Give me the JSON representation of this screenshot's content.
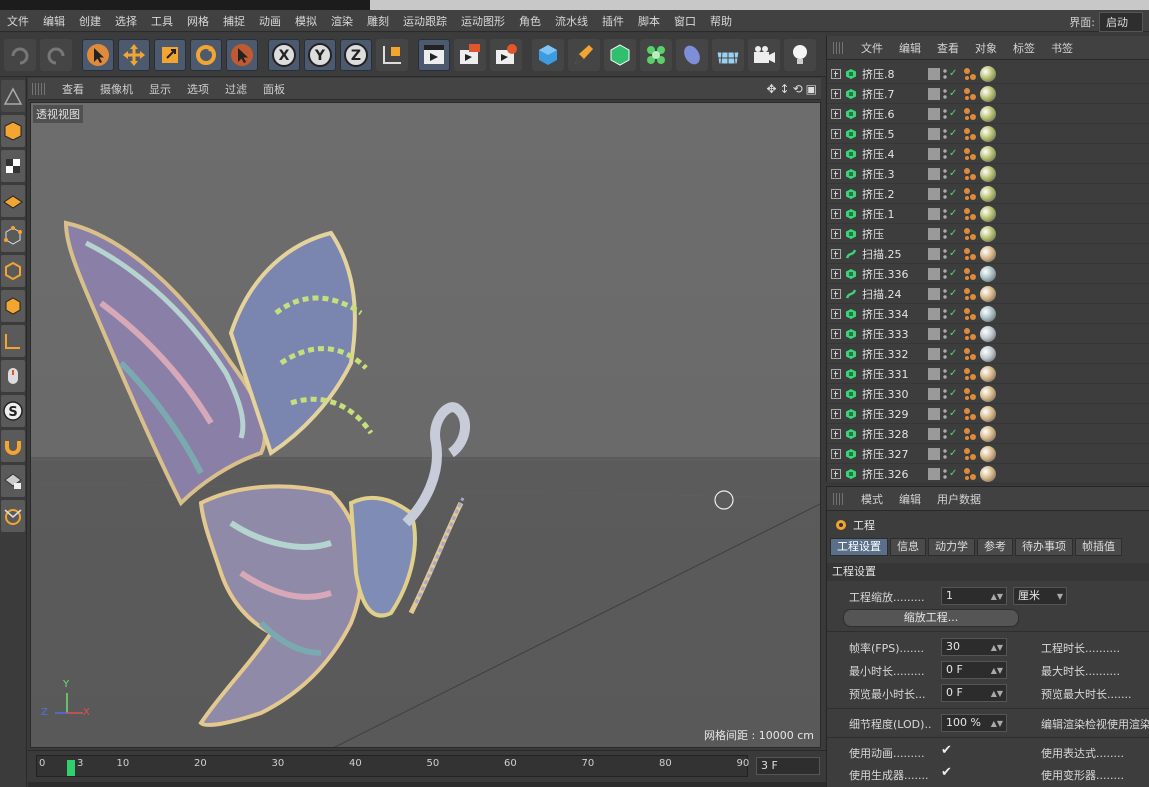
{
  "menus": [
    "文件",
    "编辑",
    "创建",
    "选择",
    "工具",
    "网格",
    "捕捉",
    "动画",
    "模拟",
    "渲染",
    "雕刻",
    "运动跟踪",
    "运动图形",
    "角色",
    "流水线",
    "插件",
    "脚本",
    "窗口",
    "帮助"
  ],
  "layout": {
    "label": "界面:",
    "value": "启动"
  },
  "toolbar_icons": [
    "undo-icon",
    "redo-icon",
    "select-arrow-icon",
    "move-icon",
    "scale-icon",
    "rotate-icon",
    "active-tool-icon",
    "x-axis-icon",
    "y-axis-icon",
    "z-axis-icon",
    "world-coord-icon",
    "render-view-icon",
    "render-picture-viewer-icon",
    "render-settings-icon",
    "cube-icon",
    "pen-icon",
    "subdivision-icon",
    "cloner-icon",
    "deformer-icon",
    "floor-icon",
    "camera-icon",
    "light-icon"
  ],
  "viewport": {
    "menus": [
      "查看",
      "摄像机",
      "显示",
      "选项",
      "过滤",
      "面板"
    ],
    "label": "透视视图",
    "grid_info": "网格间距 : 10000 cm",
    "axis_labels": {
      "x": "X",
      "y": "Y",
      "z": "Z"
    }
  },
  "timeline": {
    "ticks": [
      "0",
      "10",
      "20",
      "30",
      "40",
      "50",
      "60",
      "70",
      "80",
      "90"
    ],
    "current_marker": "3",
    "frame_field": "3 F"
  },
  "object_manager": {
    "menus": [
      "文件",
      "编辑",
      "查看",
      "对象",
      "标签",
      "书签"
    ],
    "objects": [
      {
        "name": "挤压.8",
        "type": "extrude",
        "mat": "#b8c070"
      },
      {
        "name": "挤压.7",
        "type": "extrude",
        "mat": "#b8c070"
      },
      {
        "name": "挤压.6",
        "type": "extrude",
        "mat": "#b8c070"
      },
      {
        "name": "挤压.5",
        "type": "extrude",
        "mat": "#b8c070"
      },
      {
        "name": "挤压.4",
        "type": "extrude",
        "mat": "#b8c070"
      },
      {
        "name": "挤压.3",
        "type": "extrude",
        "mat": "#b8c070"
      },
      {
        "name": "挤压.2",
        "type": "extrude",
        "mat": "#b8c070"
      },
      {
        "name": "挤压.1",
        "type": "extrude",
        "mat": "#b8c070"
      },
      {
        "name": "挤压",
        "type": "extrude",
        "mat": "#b8c070"
      },
      {
        "name": "扫描.25",
        "type": "sweep",
        "mat": "#d8b888"
      },
      {
        "name": "挤压.336",
        "type": "extrude",
        "mat": "#a8c0c8"
      },
      {
        "name": "扫描.24",
        "type": "sweep",
        "mat": "#d8b888"
      },
      {
        "name": "挤压.334",
        "type": "extrude",
        "mat": "#a8c0c8"
      },
      {
        "name": "挤压.333",
        "type": "extrude",
        "mat": "#c0c8d0"
      },
      {
        "name": "挤压.332",
        "type": "extrude",
        "mat": "#c0c8d0"
      },
      {
        "name": "挤压.331",
        "type": "extrude",
        "mat": "#d8b888"
      },
      {
        "name": "挤压.330",
        "type": "extrude",
        "mat": "#d8b888"
      },
      {
        "name": "挤压.329",
        "type": "extrude",
        "mat": "#d8b888"
      },
      {
        "name": "挤压.328",
        "type": "extrude",
        "mat": "#d8b888"
      },
      {
        "name": "挤压.327",
        "type": "extrude",
        "mat": "#d8b888"
      },
      {
        "name": "挤压.326",
        "type": "extrude",
        "mat": "#d8b888"
      }
    ]
  },
  "attributes": {
    "menus": [
      "模式",
      "编辑",
      "用户数据"
    ],
    "title": "工程",
    "tabs": [
      "工程设置",
      "信息",
      "动力学",
      "参考",
      "待办事项",
      "帧插值"
    ],
    "active_tab": "工程设置",
    "section": "工程设置",
    "scale_label": "工程缩放.........",
    "scale_value": "1",
    "scale_unit": "厘米",
    "scale_button": "缩放工程...",
    "fps_label": "帧率(FPS).......",
    "fps_value": "30",
    "project_length_label": "工程时长..........",
    "min_time_label": "最小时长.........",
    "min_time_value": "0 F",
    "max_time_label": "最大时长..........",
    "preview_min_label": "预览最小时长...",
    "preview_min_value": "0 F",
    "preview_max_label": "预览最大时长.......",
    "lod_label": "细节程度(LOD)..",
    "lod_value": "100 %",
    "render_lod_label": "编辑渲染检视使用渲染",
    "use_anim_label": "使用动画.........",
    "use_gen_label": "使用生成器.......",
    "use_expr_label": "使用表达式........",
    "use_deform_label": "使用变形器........"
  },
  "colors": {
    "accent_blue": "#5a6f8a",
    "check_green": "#4bdb6b",
    "timeline_cursor": "#2fd16e"
  }
}
